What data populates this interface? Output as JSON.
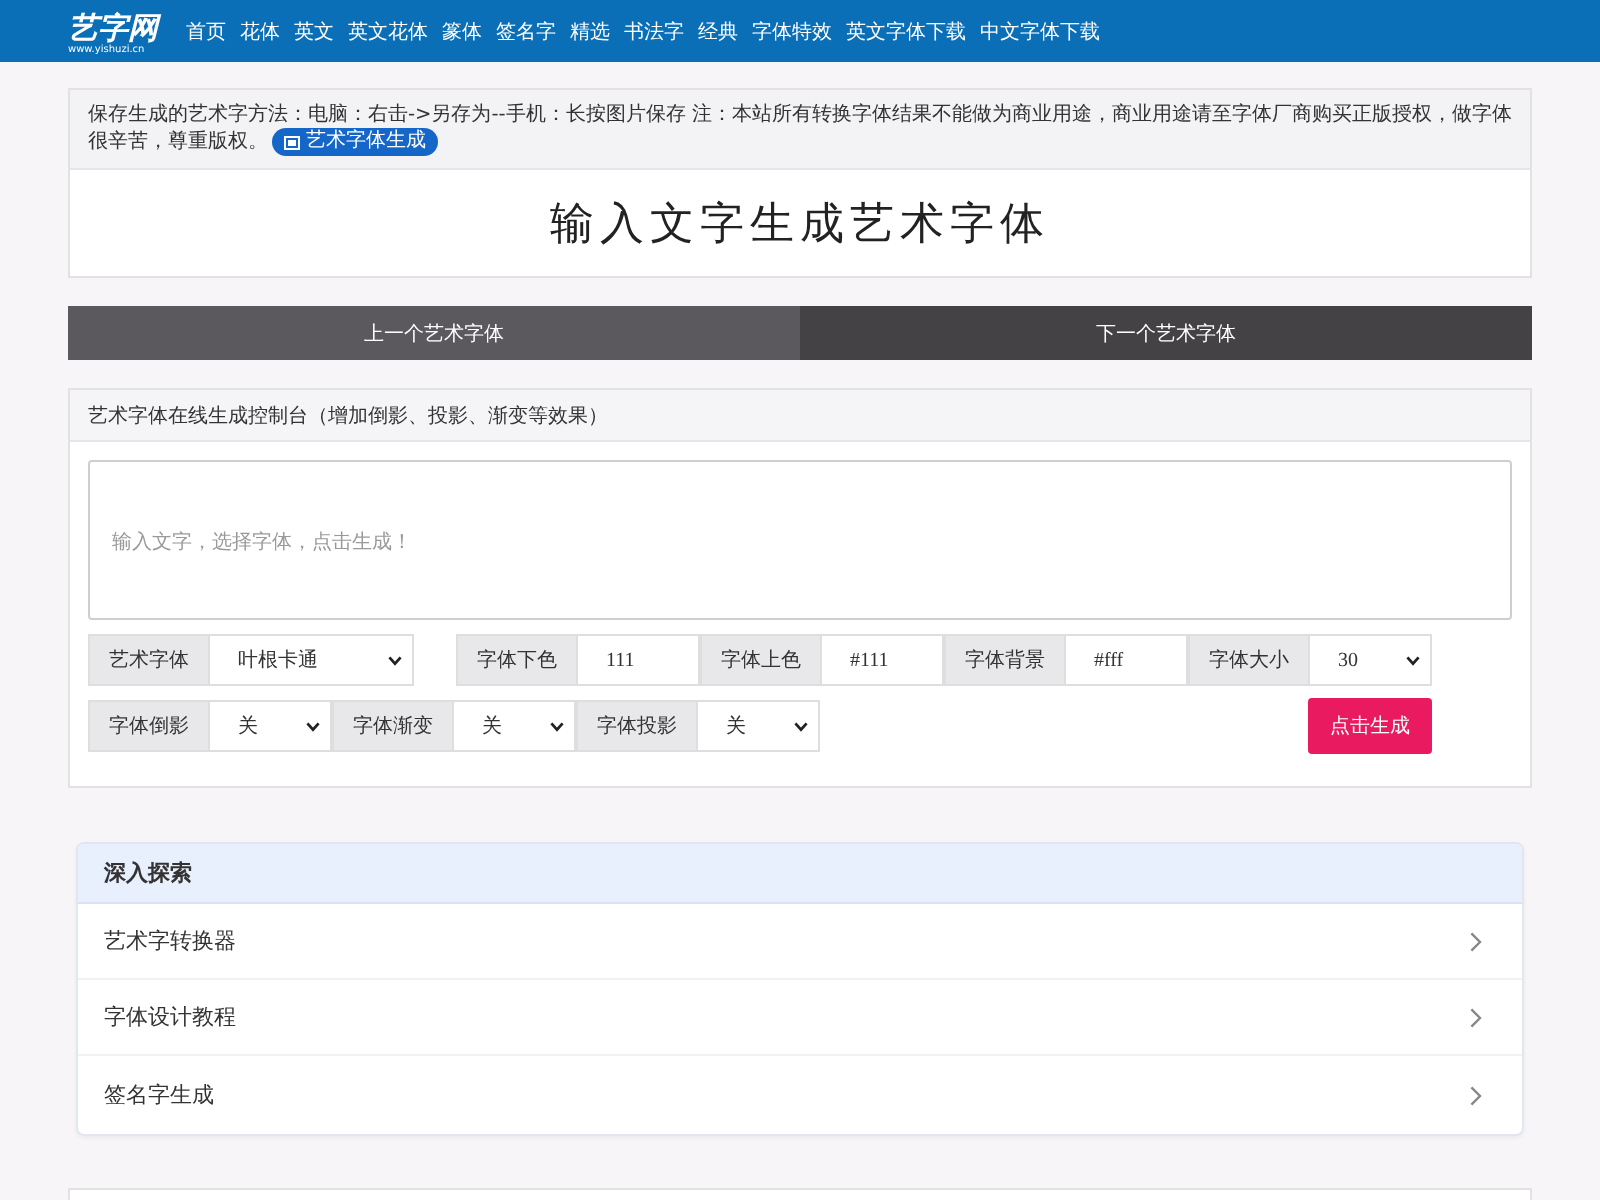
{
  "header": {
    "logo": "艺字网",
    "logo_domain": "www.yishuzi.cn",
    "nav": [
      "首页",
      "花体",
      "英文",
      "英文花体",
      "篆体",
      "签名字",
      "精选",
      "书法字",
      "经典",
      "字体特效",
      "英文字体下载",
      "中文字体下载"
    ]
  },
  "notice": {
    "text": "保存生成的艺术字方法：电脑：右击->另存为--手机：长按图片保存 注：本站所有转换字体结果不能做为商业用途，商业用途请至字体厂商购买正版授权，做字体很辛苦，尊重版权。",
    "badge": "艺术字体生成",
    "preview_text": "输入文字生成艺术字体"
  },
  "pager": [
    {
      "kind": "prev",
      "label": "上一个艺术字体"
    },
    {
      "kind": "next",
      "label": "下一个艺术字体"
    }
  ],
  "generator": {
    "title": "艺术字体在线生成控制台（增加倒影、投影、渐变等效果）",
    "text_input": {
      "placeholder": "输入文字，选择字体，点击生成！"
    },
    "rows": [
      [
        [
          {
            "label": "艺术字体",
            "kind": "select",
            "value": "叶根卡通"
          }
        ],
        [
          {
            "label": "字体下色",
            "kind": "text",
            "value": "111"
          },
          {
            "label": "字体上色",
            "kind": "text",
            "value": "#111"
          },
          {
            "label": "字体背景",
            "kind": "text",
            "value": "#fff"
          },
          {
            "label": "字体大小",
            "kind": "select",
            "value": "30"
          }
        ]
      ],
      [
        [
          {
            "label": "字体倒影",
            "kind": "select",
            "value": "关"
          },
          {
            "label": "字体渐变",
            "kind": "select",
            "value": "关"
          },
          {
            "label": "字体投影",
            "kind": "select",
            "value": "关"
          }
        ]
      ]
    ],
    "submit": "点击生成"
  },
  "explore": {
    "title": "深入探索",
    "items": [
      "艺术字转换器",
      "字体设计教程",
      "签名字生成"
    ]
  }
}
